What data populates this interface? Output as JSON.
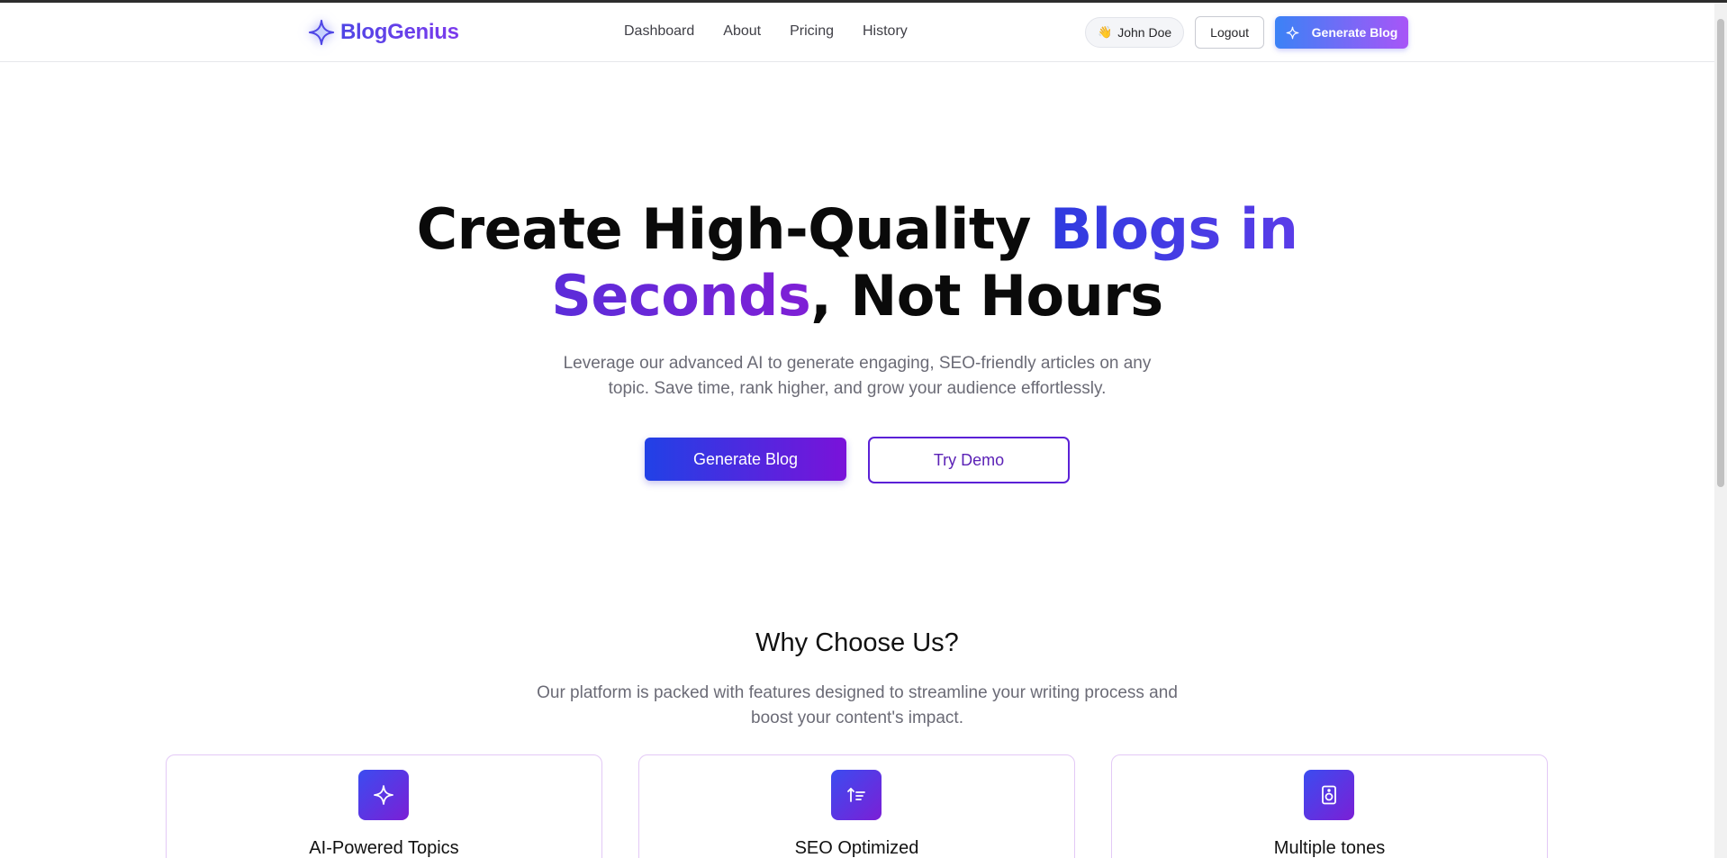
{
  "brand": {
    "name": "BlogGenius",
    "icon": "sparkle-icon"
  },
  "nav": {
    "links": [
      {
        "label": "Dashboard"
      },
      {
        "label": "About"
      },
      {
        "label": "Pricing"
      },
      {
        "label": "History"
      }
    ],
    "user": {
      "emoji": "👋",
      "name": "John Doe"
    },
    "logout_label": "Logout",
    "generate_label": "Generate Blog"
  },
  "hero": {
    "title_part1": "Create High-Quality ",
    "title_grad1": "Blogs in",
    "title_grad2": "Seconds",
    "title_part2": ", Not Hours",
    "subtitle": "Leverage our advanced AI to generate engaging, SEO-friendly articles on any topic. Save time, rank higher, and grow your audience effortlessly.",
    "primary_button": "Generate Blog",
    "secondary_button": "Try Demo"
  },
  "features": {
    "title": "Why Choose Us?",
    "subtitle": "Our platform is packed with features designed to streamline your writing process and boost your content's impact.",
    "cards": [
      {
        "title": "AI-Powered Topics",
        "icon": "sparkle-icon"
      },
      {
        "title": "SEO Optimized",
        "icon": "sort-ascending-icon"
      },
      {
        "title": "Multiple tones",
        "icon": "speaker-icon"
      }
    ]
  },
  "colors": {
    "brand_primary": "#4f46e5",
    "brand_secondary": "#7c3aed",
    "card_border": "#e3c9f6"
  }
}
